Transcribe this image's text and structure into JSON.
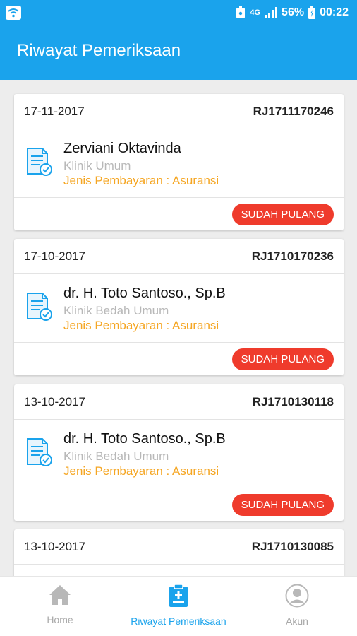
{
  "status_bar": {
    "network": "4G",
    "battery": "56%",
    "time": "00:22"
  },
  "header": {
    "title": "Riwayat Pemeriksaan"
  },
  "records": [
    {
      "date": "17-11-2017",
      "reg_no": "RJ1711170246",
      "doctor": "Zerviani Oktavinda",
      "clinic": "Klinik Umum",
      "payment": "Jenis Pembayaran : Asuransi",
      "status": "SUDAH PULANG"
    },
    {
      "date": "17-10-2017",
      "reg_no": "RJ1710170236",
      "doctor": "dr. H. Toto Santoso., Sp.B",
      "clinic": "Klinik Bedah Umum",
      "payment": "Jenis Pembayaran : Asuransi",
      "status": "SUDAH PULANG"
    },
    {
      "date": "13-10-2017",
      "reg_no": "RJ1710130118",
      "doctor": "dr. H. Toto Santoso., Sp.B",
      "clinic": "Klinik Bedah Umum",
      "payment": "Jenis Pembayaran : Asuransi",
      "status": "SUDAH PULANG"
    },
    {
      "date": "13-10-2017",
      "reg_no": "RJ1710130085"
    }
  ],
  "bottom_nav": {
    "items": [
      {
        "label": "Home",
        "icon": "home-icon"
      },
      {
        "label": "Riwayat Pemeriksaan",
        "icon": "clipboard-medical-icon"
      },
      {
        "label": "Akun",
        "icon": "user-circle-icon"
      }
    ],
    "active_color": "#1aa3ec"
  },
  "colors": {
    "primary": "#1aa3ec",
    "payment": "#f5a623",
    "status_badge": "#ef3b2c"
  }
}
